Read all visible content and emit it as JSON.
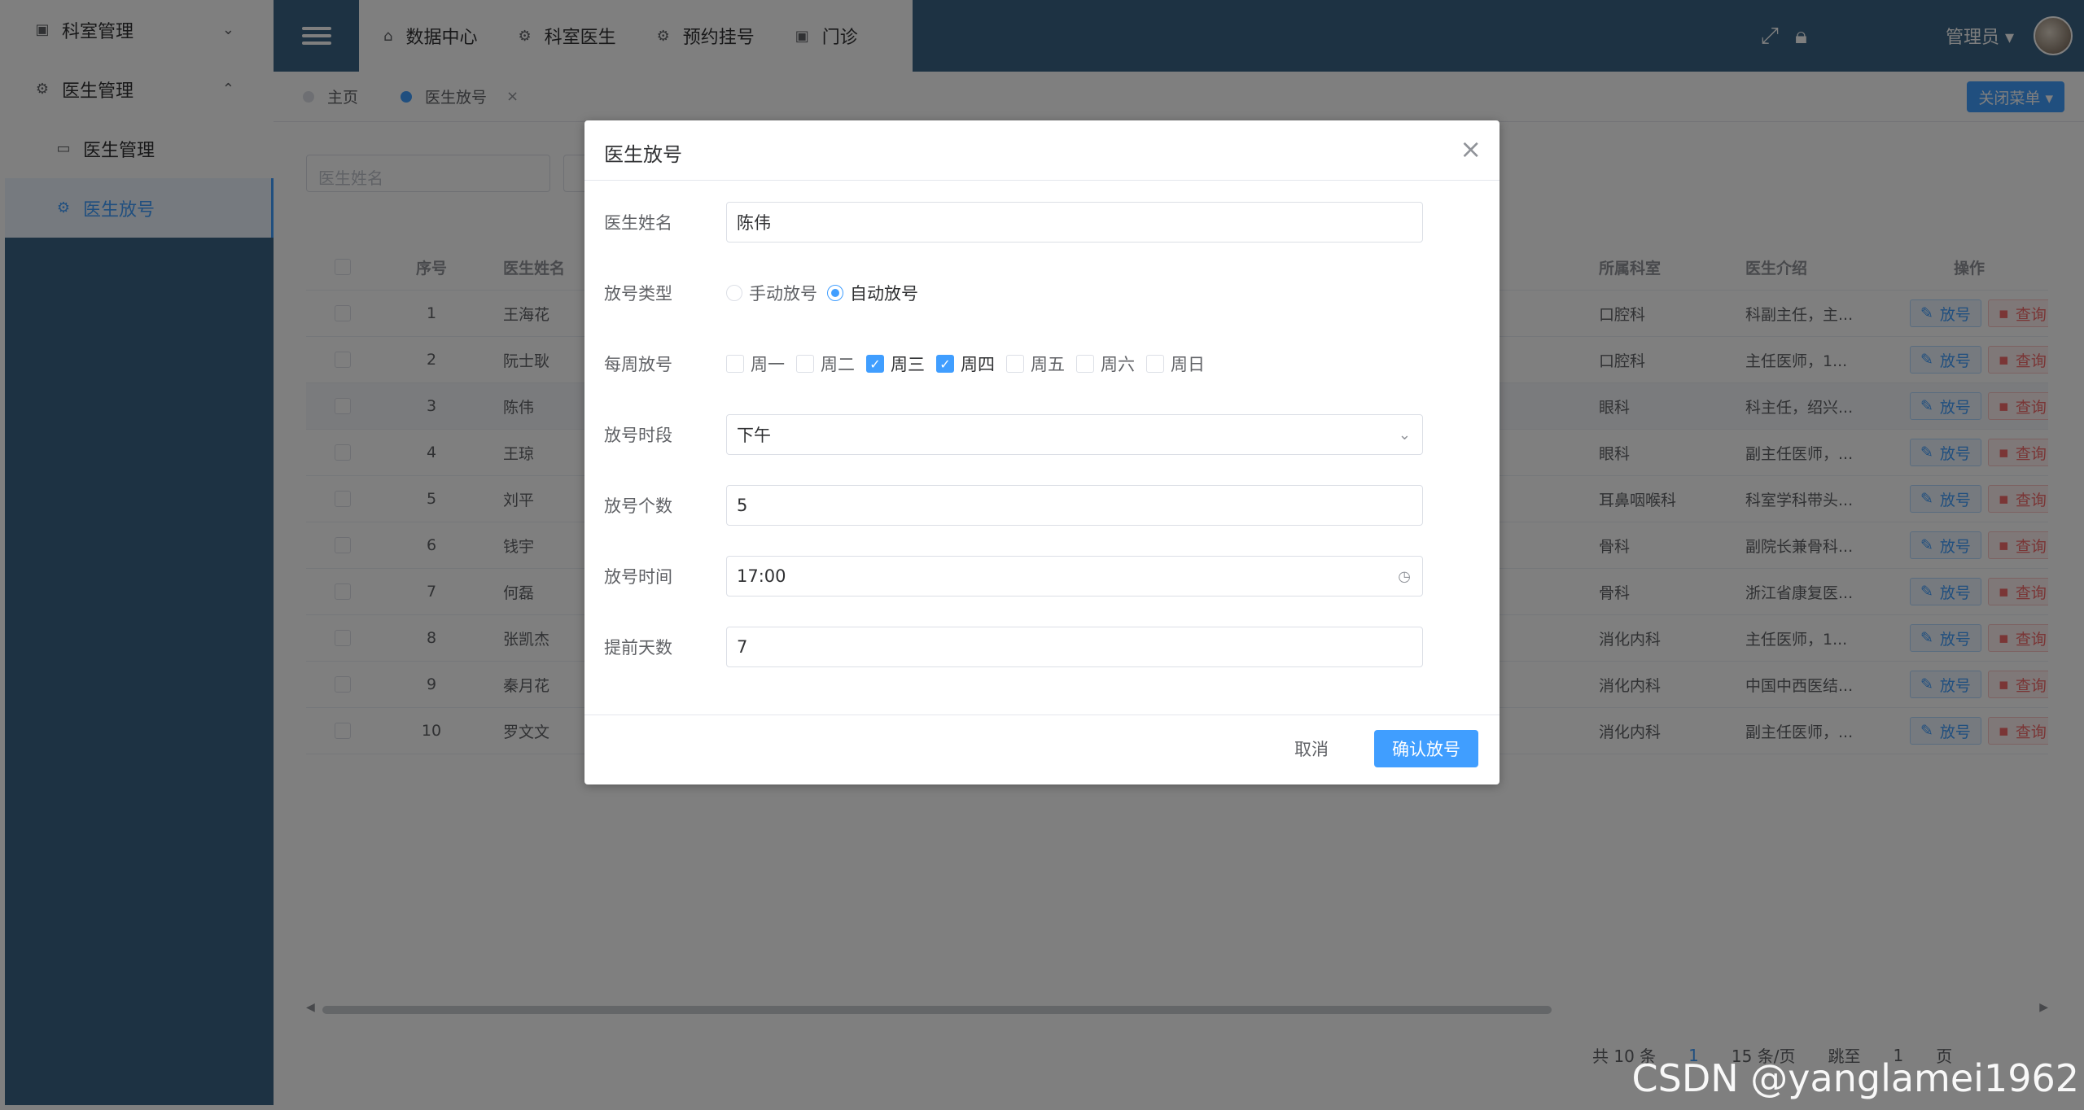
{
  "sidebar": {
    "items": [
      {
        "label": "科室管理",
        "icon": "chart-icon",
        "chevron": "⌄"
      },
      {
        "label": "医生管理",
        "icon": "gear-icon",
        "chevron": "⌃"
      },
      {
        "label": "医生管理",
        "icon": "basket-icon"
      },
      {
        "label": "医生放号",
        "icon": "gear-icon"
      }
    ]
  },
  "header": {
    "nav": [
      {
        "label": "数据中心",
        "icon": "home-icon"
      },
      {
        "label": "科室医生",
        "icon": "gear-icon"
      },
      {
        "label": "预约挂号",
        "icon": "gear-icon"
      },
      {
        "label": "门诊",
        "icon": "bag-icon"
      }
    ],
    "user": "管理员 ▾"
  },
  "tabs": [
    {
      "label": "主页"
    },
    {
      "label": "医生放号",
      "close": "×"
    }
  ],
  "close_menu": "关闭菜单 ▾",
  "filter": {
    "placeholder": "医生姓名"
  },
  "table": {
    "headers": {
      "no": "序号",
      "name": "医生姓名",
      "dept": "所属科室",
      "intro": "医生介绍",
      "op": "操作"
    },
    "rows": [
      {
        "no": "1",
        "name": "王海花",
        "dept": "口腔科",
        "intro": "科副主任，主..."
      },
      {
        "no": "2",
        "name": "阮士耿",
        "dept": "口腔科",
        "intro": "主任医师，1..."
      },
      {
        "no": "3",
        "name": "陈伟",
        "dept": "眼科",
        "intro": "科主任，绍兴..."
      },
      {
        "no": "4",
        "name": "王琼",
        "dept": "眼科",
        "intro": "副主任医师，..."
      },
      {
        "no": "5",
        "name": "刘平",
        "dept": "耳鼻咽喉科",
        "intro": "科室学科带头..."
      },
      {
        "no": "6",
        "name": "钱宇",
        "dept": "骨科",
        "intro": "副院长兼骨科..."
      },
      {
        "no": "7",
        "name": "何磊",
        "dept": "骨科",
        "intro": "浙江省康复医..."
      },
      {
        "no": "8",
        "name": "张凯杰",
        "dept": "消化内科",
        "intro": "主任医师，1..."
      },
      {
        "no": "9",
        "name": "秦月花",
        "dept": "消化内科",
        "intro": "中国中西医结..."
      },
      {
        "no": "10",
        "name": "罗文文",
        "dept": "消化内科",
        "intro": "副主任医师，..."
      }
    ],
    "btn_release": "放号",
    "btn_query": "查询"
  },
  "pager": {
    "total": "共 10 条",
    "page": "1",
    "size": "15 条/页",
    "jump": "跳至",
    "jump_val": "1",
    "unit": "页"
  },
  "dialog": {
    "title": "医生放号",
    "close": "×",
    "fields": {
      "name_label": "医生姓名",
      "name_value": "陈伟",
      "type_label": "放号类型",
      "type_manual": "手动放号",
      "type_auto": "自动放号",
      "week_label": "每周放号",
      "weekdays": [
        {
          "label": "周一",
          "checked": false
        },
        {
          "label": "周二",
          "checked": false
        },
        {
          "label": "周三",
          "checked": true
        },
        {
          "label": "周四",
          "checked": true
        },
        {
          "label": "周五",
          "checked": false
        },
        {
          "label": "周六",
          "checked": false
        },
        {
          "label": "周日",
          "checked": false
        }
      ],
      "period_label": "放号时段",
      "period_value": "下午",
      "count_label": "放号个数",
      "count_value": "5",
      "time_label": "放号时间",
      "time_value": "17:00",
      "days_label": "提前天数",
      "days_value": "7"
    },
    "cancel": "取消",
    "confirm": "确认放号"
  },
  "watermark": "CSDN @yanglamei1962",
  "colors": {
    "primary": "#409eff",
    "sidebar": "#3a6587",
    "danger": "#f56c6c"
  }
}
